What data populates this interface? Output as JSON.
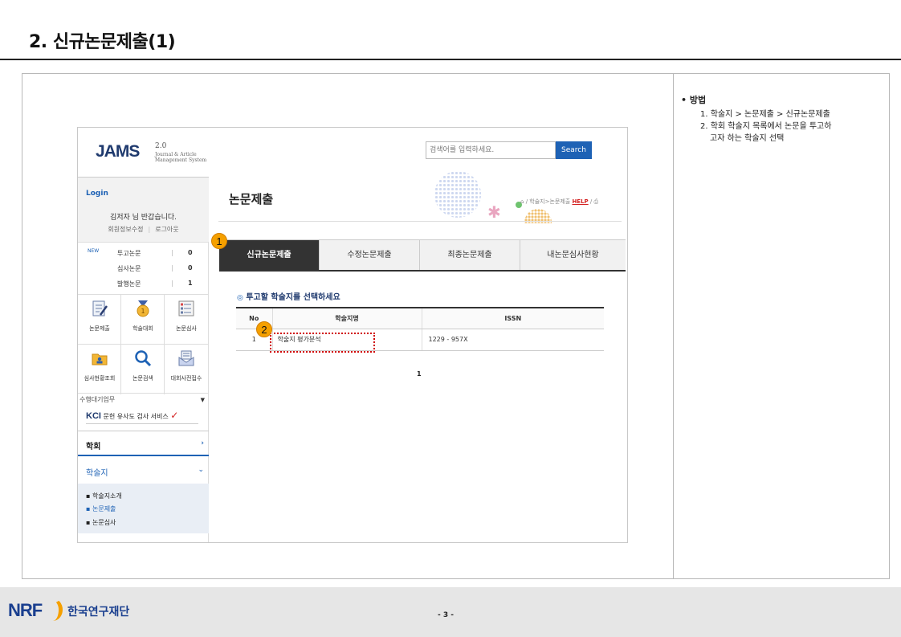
{
  "doc": {
    "title": "2. 신규논문제출(1)",
    "page_number": "- 3 -",
    "org_name": "한국연구재단",
    "logo_text": "NRF"
  },
  "notes": {
    "title": "방법",
    "steps": [
      "1. 학술지 > 논문제출 > 신규논문제출",
      "2. 학회 학술지 목록에서 논문을 투고하",
      "고자 하는 학술지 선택"
    ]
  },
  "app": {
    "logo": {
      "name": "JAMS",
      "version": "2.0",
      "subtitle": "Journal & Article Management System"
    },
    "search": {
      "placeholder": "검색어를 입력하세요.",
      "button": "Search"
    },
    "login": {
      "label": "Login",
      "greeting": "김저자 님 반갑습니다.",
      "account_info": "회원정보수정",
      "logout": "로그아웃"
    },
    "stats": [
      {
        "new": "NEW",
        "label": "투고논문",
        "count": "0"
      },
      {
        "new": "",
        "label": "심사논문",
        "count": "0"
      },
      {
        "new": "",
        "label": "발행논문",
        "count": "1"
      }
    ],
    "quick_menu": [
      {
        "label": "논문제출",
        "icon": "document-edit-icon"
      },
      {
        "label": "학술대회",
        "icon": "medal-icon"
      },
      {
        "label": "논문심사",
        "icon": "checklist-icon"
      },
      {
        "label": "심사현황조회",
        "icon": "folder-user-icon"
      },
      {
        "label": "논문검색",
        "icon": "magnifier-icon"
      },
      {
        "label": "대회사전접수",
        "icon": "envelope-icon"
      }
    ],
    "task_select": "수행대기업무",
    "kci": {
      "mark": "KCI",
      "text": "문헌 유사도 검사 서비스"
    },
    "menu": {
      "society": "학회",
      "journal": "학술지",
      "submenu": [
        "학술지소개",
        "논문제출",
        "논문심사"
      ]
    },
    "page_heading": "논문제출",
    "breadcrumb": {
      "path": "/ 학술지>논문제출",
      "help": "HELP"
    },
    "tabs": [
      "신규논문제출",
      "수정논문제출",
      "최종논문제출",
      "내논문심사현황"
    ],
    "instruction": "투고할 학술지를 선택하세요",
    "table": {
      "headers": [
        "No",
        "학술지명",
        "ISSN"
      ],
      "rows": [
        {
          "no": "1",
          "name": "학술지 평가분석",
          "issn": "1229 - 957X"
        }
      ]
    },
    "pager": "1",
    "badges": [
      "1",
      "2"
    ]
  },
  "colors": {
    "accent": "#1e62b5",
    "badge": "#f5a000",
    "highlight": "#d00000"
  }
}
